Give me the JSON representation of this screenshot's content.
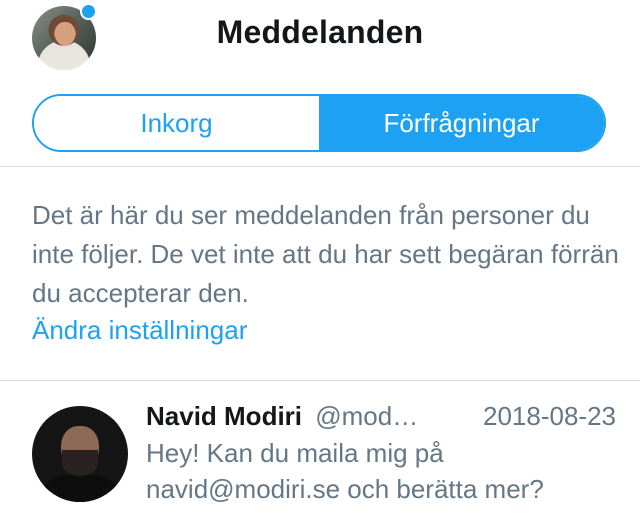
{
  "header": {
    "title": "Meddelanden",
    "avatar_icon": "profile-avatar",
    "notification_color": "#1da1f2"
  },
  "tabs": [
    {
      "label": "Inkorg",
      "active": false
    },
    {
      "label": "Förfrågningar",
      "active": true
    }
  ],
  "info": {
    "text": "Det är här du ser meddelanden från personer du inte följer. De vet inte att du har sett begäran förrän du accepterar den.",
    "link": "Ändra inställningar"
  },
  "messages": [
    {
      "name": "Navid Modiri",
      "handle": "@mod…",
      "date": "2018-08-23",
      "preview": "Hey! Kan du maila mig på navid@modiri.se och berätta mer?"
    }
  ],
  "colors": {
    "accent": "#1da1f2",
    "secondary_text": "#657786",
    "primary_text": "#14171a"
  }
}
